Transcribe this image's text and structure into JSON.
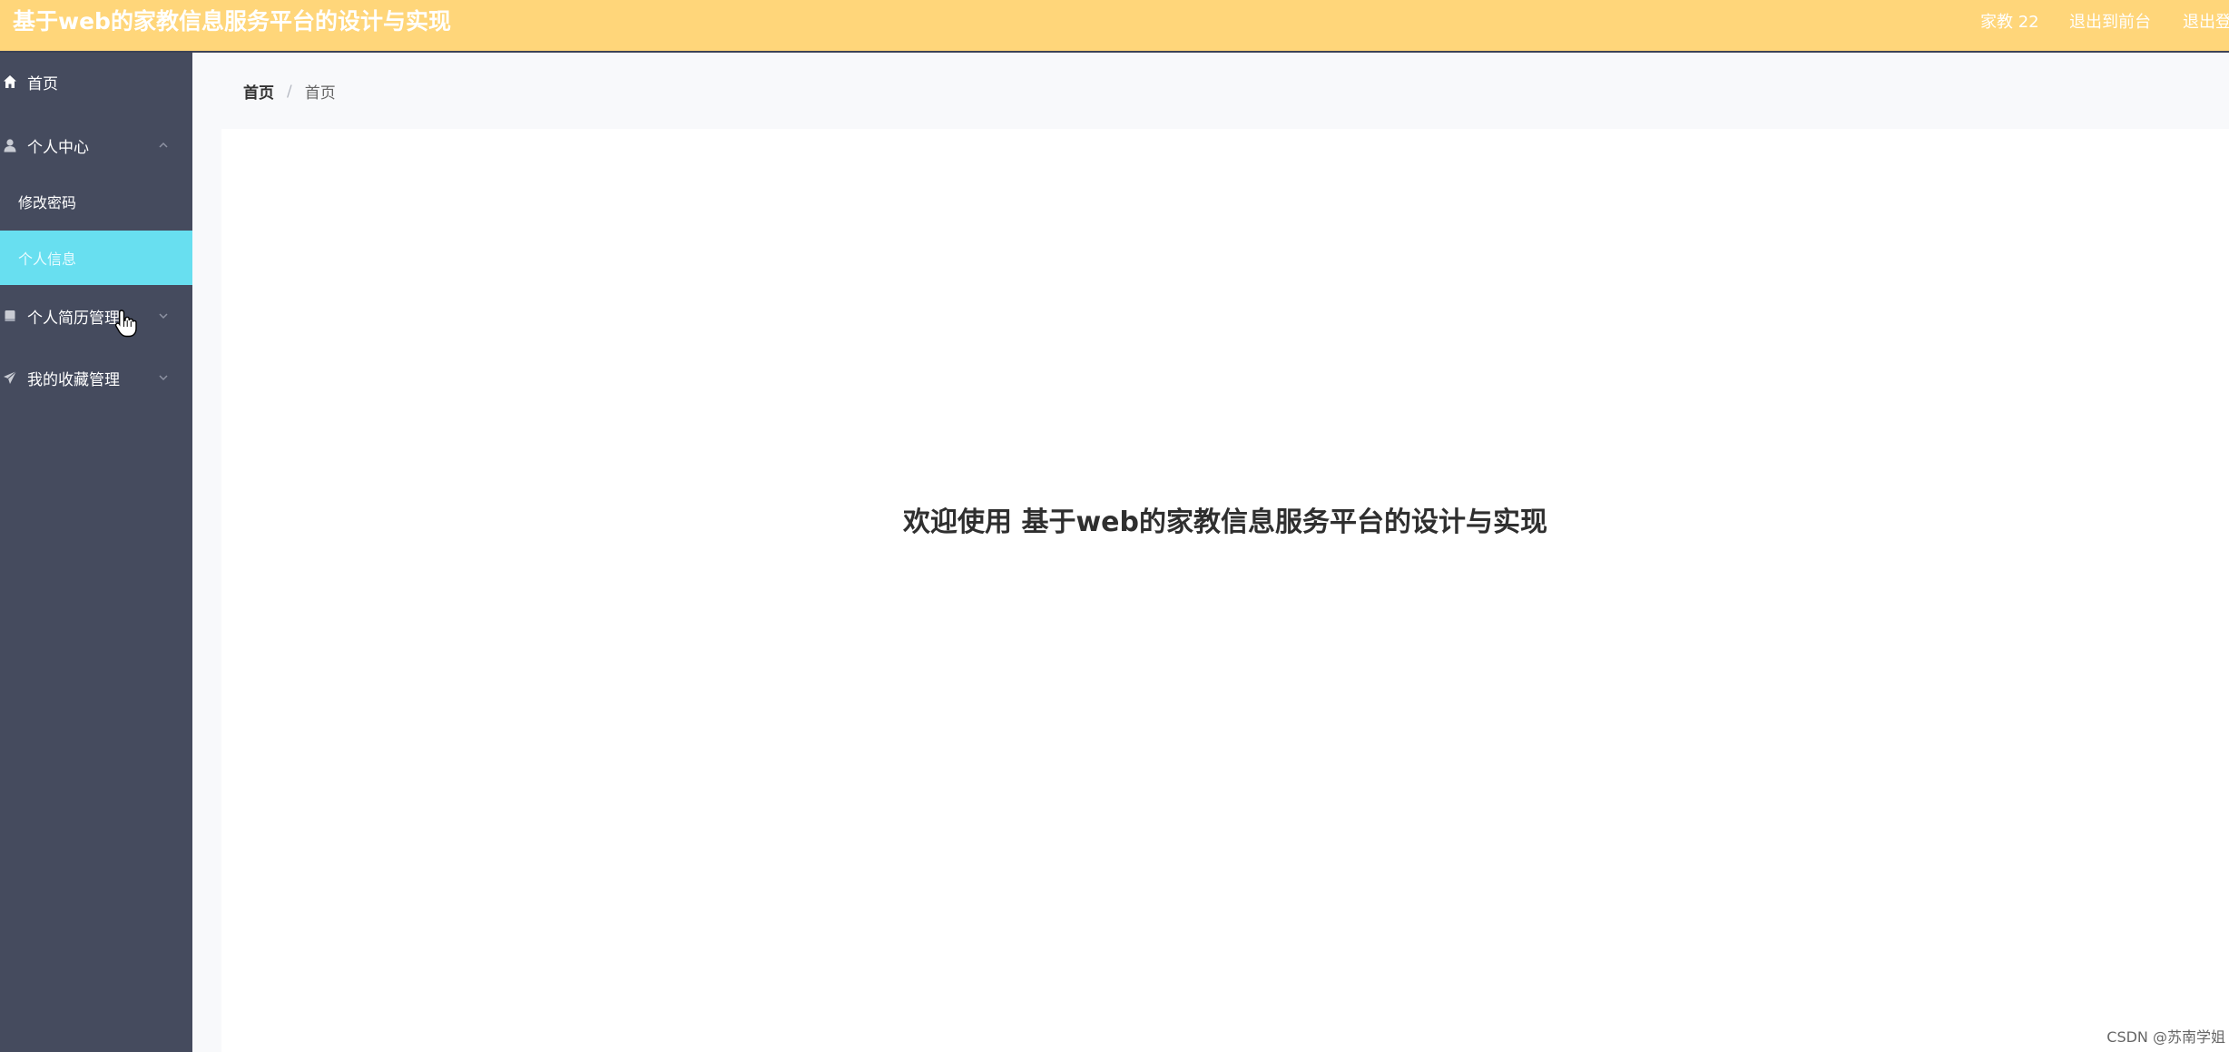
{
  "header": {
    "title": "基于web的家教信息服务平台的设计与实现",
    "user": "家教 22",
    "to_front": "退出到前台",
    "logout": "退出登"
  },
  "sidebar": {
    "items": [
      {
        "label": "首页",
        "icon": "home-icon"
      },
      {
        "label": "个人中心",
        "icon": "user-icon",
        "expanded": true,
        "children": [
          {
            "label": "修改密码"
          },
          {
            "label": "个人信息",
            "active": true
          }
        ]
      },
      {
        "label": "个人简历管理",
        "icon": "document-icon",
        "expanded": false
      },
      {
        "label": "我的收藏管理",
        "icon": "send-icon",
        "expanded": false
      }
    ]
  },
  "breadcrumb": {
    "home": "首页",
    "separator": "/",
    "current": "首页"
  },
  "main": {
    "welcome": "欢迎使用 基于web的家教信息服务平台的设计与实现"
  },
  "watermark": "CSDN @苏南学姐",
  "colors": {
    "topbar": "#ffd67a",
    "sidebar": "#454b5e",
    "active_item": "#68dff0",
    "background": "#f8f9fb"
  }
}
